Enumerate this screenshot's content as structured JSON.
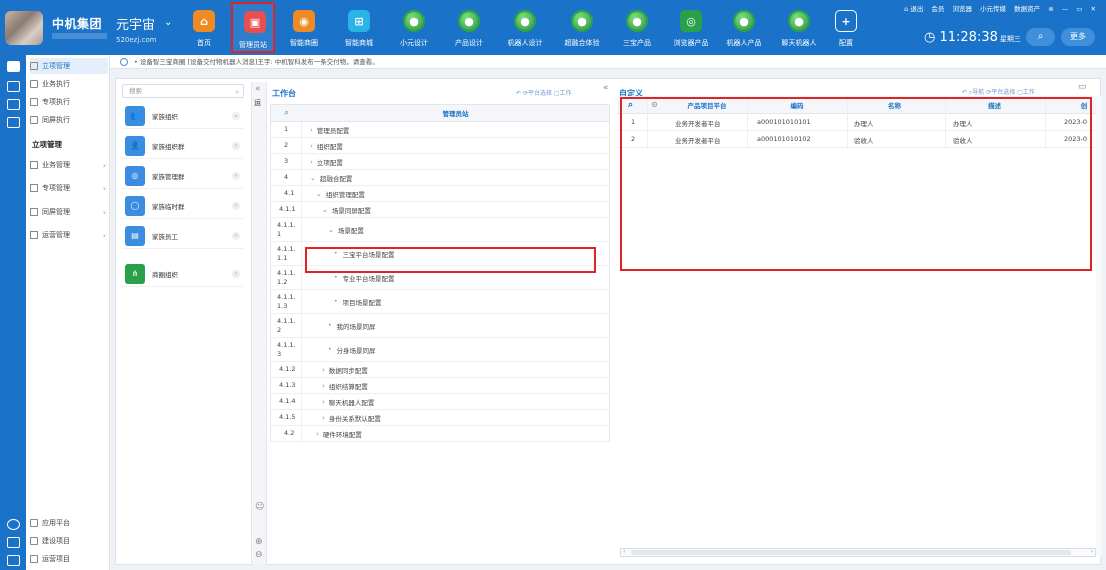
{
  "header": {
    "company": "中机集团",
    "brand": "元宇宙",
    "domain": "520ezj.com",
    "nav": [
      {
        "label": "首页",
        "icon": "home-icon",
        "color": "#f08a24"
      },
      {
        "label": "管理员站",
        "icon": "admin-icon",
        "color": "#e85050"
      },
      {
        "label": "智能商圈",
        "icon": "ring-icon",
        "color": "#f08a24"
      },
      {
        "label": "智能商城",
        "icon": "cart-icon",
        "color": "#2ab3e6"
      },
      {
        "label": "小元设计",
        "icon": "globe-icon",
        "color": "#2aa04a"
      },
      {
        "label": "产品设计",
        "icon": "robot-icon",
        "color": "#2aa04a"
      },
      {
        "label": "机器人设计",
        "icon": "robot-icon",
        "color": "#2aa04a"
      },
      {
        "label": "超融合体验",
        "icon": "robot-icon",
        "color": "#2aa04a"
      },
      {
        "label": "三宝产品",
        "icon": "robot-icon",
        "color": "#2aa04a"
      },
      {
        "label": "浏览器产品",
        "icon": "browser-icon",
        "color": "#2aa04a"
      },
      {
        "label": "机器人产品",
        "icon": "globe-icon",
        "color": "#2aa04a"
      },
      {
        "label": "聊天机器人",
        "icon": "robot-icon",
        "color": "#2aa04a"
      },
      {
        "label": "配置",
        "icon": "plus-icon",
        "color": "#1a73c8"
      }
    ],
    "top_links": [
      "退出",
      "会员",
      "浏览器",
      "小元传媒",
      "数据资产"
    ],
    "time": "11:28:38",
    "weekday": "星期三",
    "more_label": "更多"
  },
  "sidebar": {
    "top_items": [
      "立项管理",
      "业务执行",
      "专项执行",
      "同屏执行"
    ],
    "section_title": "立项管理",
    "groups": [
      "业务管理",
      "专项管理",
      "同屏管理",
      "运营管理"
    ],
    "bottom_items": [
      "应用平台",
      "建设项目",
      "运营项目"
    ]
  },
  "breadcrumb": "• 设备智三宝商圈 [设备交付物机器人消息]王宇: 中机智科发布一条交付物，请查看。",
  "left_panel": {
    "search_placeholder": "搜索",
    "orgs": [
      {
        "name": "家族组织",
        "color": "#3b8de0",
        "icon": "users-icon"
      },
      {
        "name": "家族组织群",
        "color": "#3b8de0",
        "icon": "user-icon"
      },
      {
        "name": "家族管理群",
        "color": "#3b8de0",
        "icon": "target-icon"
      },
      {
        "name": "家族临时群",
        "color": "#3b8de0",
        "icon": "circle-icon"
      },
      {
        "name": "家族员工",
        "color": "#3b8de0",
        "icon": "badge-icon"
      },
      {
        "name": "商圈组织",
        "color": "#2aa04a",
        "icon": "tree-icon"
      }
    ]
  },
  "workbench": {
    "title": "工作台",
    "tools": [
      "平台选择",
      "工作"
    ],
    "column_header": "管理员站",
    "rows": [
      {
        "num": "1",
        "label": "管理员配置",
        "kind": "caret",
        "indent": 0
      },
      {
        "num": "2",
        "label": "组织配置",
        "kind": "caret",
        "indent": 0
      },
      {
        "num": "3",
        "label": "立项配置",
        "kind": "caret",
        "indent": 0
      },
      {
        "num": "4",
        "label": "超融合配置",
        "kind": "open",
        "indent": 0
      },
      {
        "num": "4.1",
        "label": "组织管理配置",
        "kind": "open",
        "indent": 1
      },
      {
        "num": "4.1.1",
        "label": "场景同屏配置",
        "kind": "open",
        "indent": 2
      },
      {
        "num": "4.1.1.1",
        "label": "场景配置",
        "kind": "open",
        "indent": 3
      },
      {
        "num": "4.1.1.1.1",
        "label": "三宝平台场景配置",
        "kind": "dot",
        "indent": 4
      },
      {
        "num": "4.1.1.1.2",
        "label": "专业平台场景配置",
        "kind": "dot",
        "indent": 4
      },
      {
        "num": "4.1.1.1.3",
        "label": "项目场景配置",
        "kind": "dot",
        "indent": 4
      },
      {
        "num": "4.1.1.2",
        "label": "我的场景同屏",
        "kind": "dot",
        "indent": 3
      },
      {
        "num": "4.1.1.3",
        "label": "分身场景同屏",
        "kind": "dot",
        "indent": 3
      },
      {
        "num": "4.1.2",
        "label": "数据同步配置",
        "kind": "caret",
        "indent": 2
      },
      {
        "num": "4.1.3",
        "label": "组织结算配置",
        "kind": "caret",
        "indent": 2
      },
      {
        "num": "4.1.4",
        "label": "聊天机器人配置",
        "kind": "caret",
        "indent": 2
      },
      {
        "num": "4.1.5",
        "label": "身份关系默认配置",
        "kind": "caret",
        "indent": 2
      },
      {
        "num": "4.2",
        "label": "硬件环境配置",
        "kind": "caret",
        "indent": 1
      }
    ]
  },
  "custom": {
    "title": "自定义",
    "tools": [
      "导航",
      "平台选择",
      "工作"
    ],
    "columns": [
      "产品项目平台",
      "编码",
      "名称",
      "描述",
      "创"
    ],
    "rows": [
      {
        "num": "1",
        "platform": "业务开发者平台",
        "code": "a000101010101",
        "name": "办理人",
        "desc": "办理人",
        "created": "2023-0"
      },
      {
        "num": "2",
        "platform": "业务开发者平台",
        "code": "a000101010102",
        "name": "验收人",
        "desc": "验收人",
        "created": "2023-0"
      }
    ]
  }
}
